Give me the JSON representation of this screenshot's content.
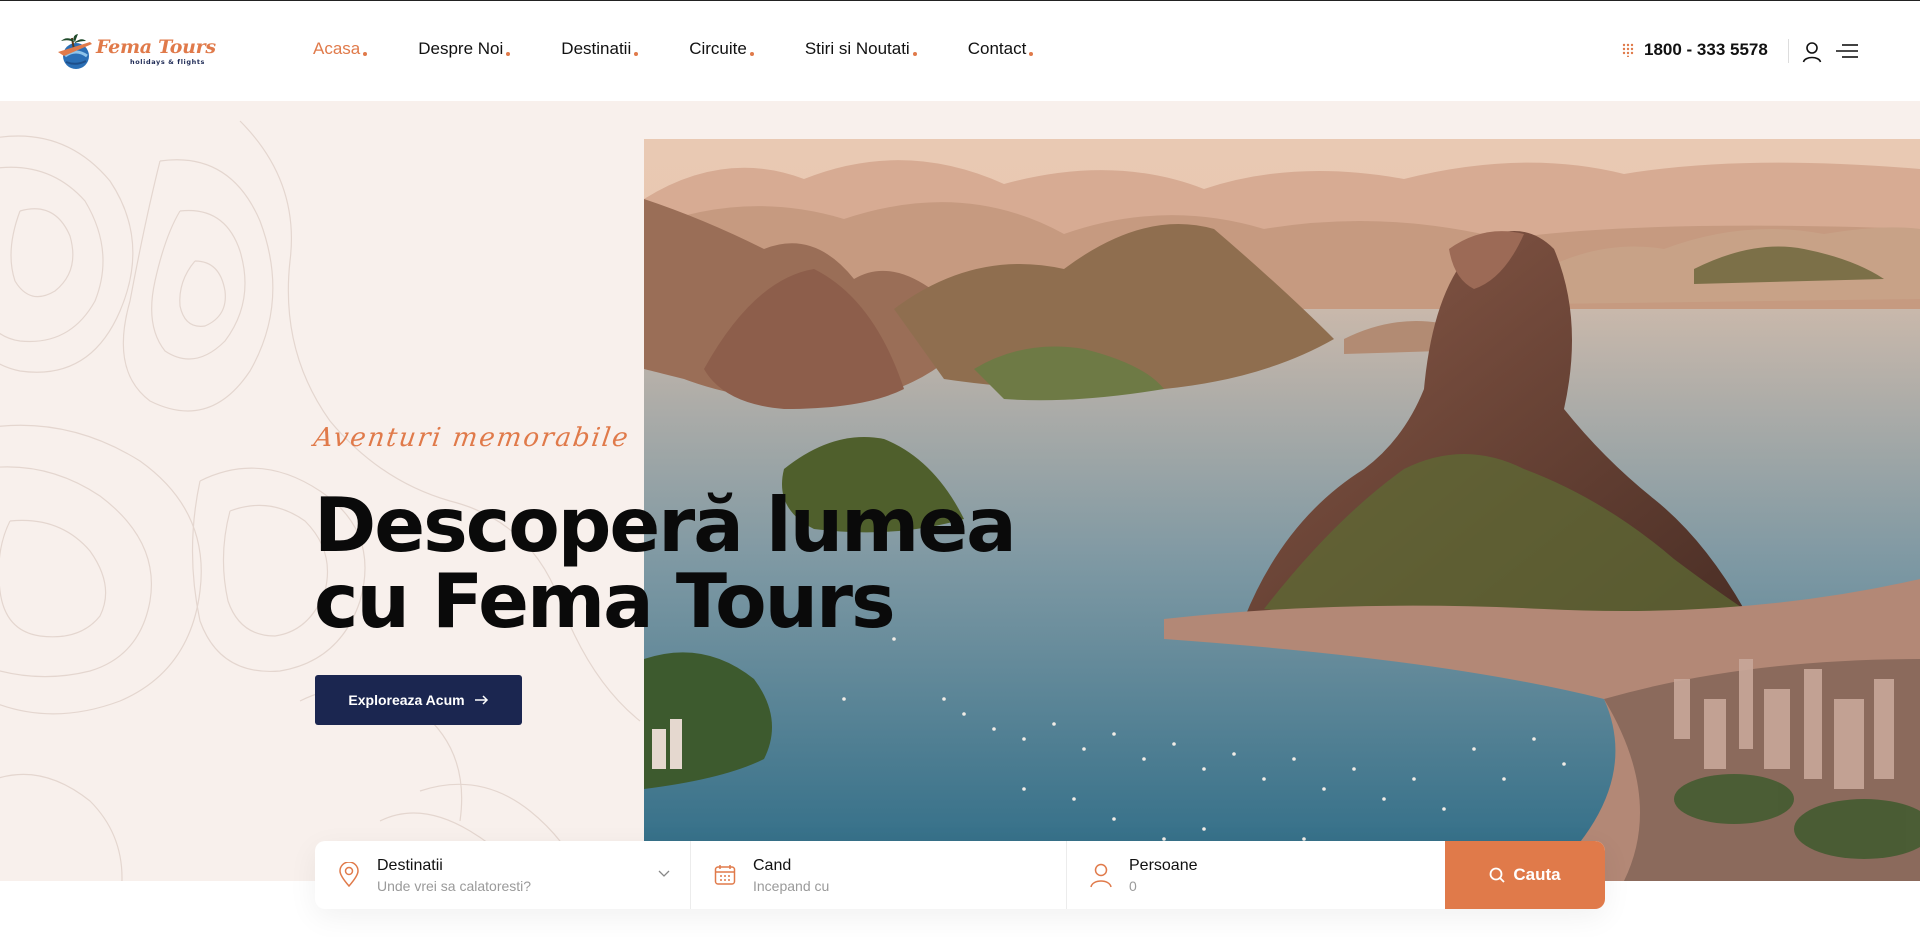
{
  "brand": {
    "name": "Fema Tours",
    "tagline": "holidays & flights"
  },
  "nav": [
    {
      "label": "Acasa",
      "active": true
    },
    {
      "label": "Despre Noi",
      "active": false
    },
    {
      "label": "Destinatii",
      "active": false
    },
    {
      "label": "Circuite",
      "active": false
    },
    {
      "label": "Stiri si Noutati",
      "active": false
    },
    {
      "label": "Contact",
      "active": false
    }
  ],
  "header": {
    "phone": "1800 - 333 5578",
    "phone_icon": "dial-pad-icon",
    "user_icon": "user-icon",
    "menu_icon": "menu-icon"
  },
  "hero": {
    "tagline": "Aventuri memorabile",
    "headline_line1": "Descoperă lumea",
    "headline_line2": "cu Fema Tours",
    "cta_label": "Exploreaza Acum",
    "image_alt": "Sugarloaf Mountain and bay view"
  },
  "search": {
    "destination": {
      "label": "Destinatii",
      "placeholder": "Unde vrei sa calatoresti?",
      "icon": "map-pin-icon"
    },
    "date": {
      "label": "Cand",
      "placeholder": "Incepand cu",
      "icon": "calendar-icon"
    },
    "people": {
      "label": "Persoane",
      "value": "0",
      "icon": "person-icon"
    },
    "button_label": "Cauta"
  },
  "colors": {
    "accent": "#e07a4a",
    "navy": "#1b2650",
    "hero_bg": "#f8f0ec"
  }
}
